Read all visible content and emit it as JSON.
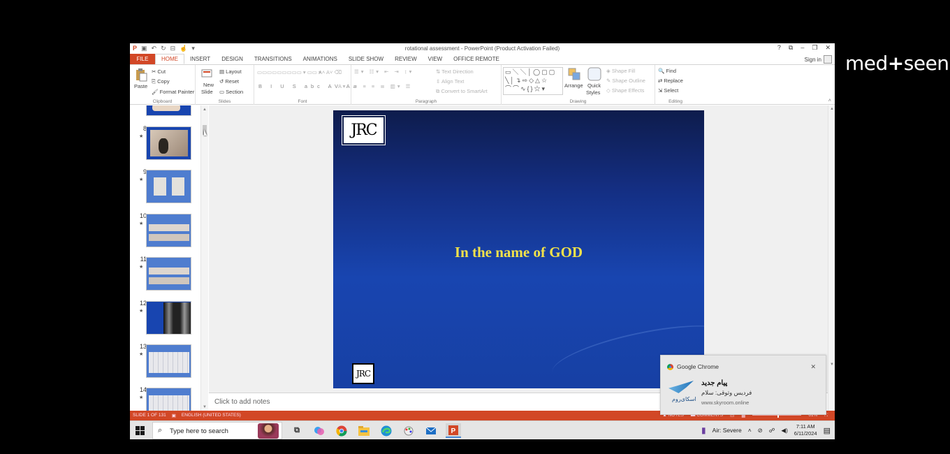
{
  "watermark": {
    "brand": "med",
    "plus": "+",
    "rest": "seen"
  },
  "window": {
    "title": "rotational assessment - PowerPoint (Product Activation Failed)",
    "controls": [
      "?",
      "⧉",
      "–",
      "❐",
      "✕"
    ],
    "sign_in": "Sign in"
  },
  "tabs": {
    "file": "FILE",
    "items": [
      "HOME",
      "INSERT",
      "DESIGN",
      "TRANSITIONS",
      "ANIMATIONS",
      "SLIDE SHOW",
      "REVIEW",
      "VIEW",
      "OFFICE REMOTE"
    ],
    "active": "HOME"
  },
  "ribbon": {
    "clipboard": {
      "paste": "Paste",
      "cut": "Cut",
      "copy": "Copy",
      "format_painter": "Format Painter",
      "label": "Clipboard"
    },
    "slides": {
      "new_slide": "New",
      "new_slide_2": "Slide",
      "layout": "Layout",
      "reset": "Reset",
      "section": "Section",
      "label": "Slides"
    },
    "font": {
      "label": "Font"
    },
    "paragraph": {
      "text_direction": "Text Direction",
      "align_text": "Align Text",
      "convert": "Convert to SmartArt",
      "label": "Paragraph"
    },
    "drawing": {
      "arrange": "Arrange",
      "quick_styles": "Quick",
      "quick_styles_2": "Styles",
      "shape_fill": "Shape Fill",
      "shape_outline": "Shape Outline",
      "shape_effects": "Shape Effects",
      "label": "Drawing"
    },
    "editing": {
      "find": "Find",
      "replace": "Replace",
      "select": "Select",
      "label": "Editing"
    }
  },
  "thumbnails": [
    {
      "num": "",
      "kind": "partial"
    },
    {
      "num": "8",
      "kind": "photo"
    },
    {
      "num": "9",
      "kind": "blue-two"
    },
    {
      "num": "10",
      "kind": "blue-rows"
    },
    {
      "num": "11",
      "kind": "blue-rows"
    },
    {
      "num": "12",
      "kind": "xray"
    },
    {
      "num": "13",
      "kind": "blue-grid"
    },
    {
      "num": "14",
      "kind": "blue-grid"
    }
  ],
  "slide": {
    "logo": "JRC",
    "logo_small": "JRC",
    "headline": "In the name of GOD"
  },
  "notes": {
    "placeholder": "Click to add notes"
  },
  "statusbar": {
    "slide": "SLIDE 1 OF 131",
    "language": "ENGLISH (UNITED STATES)",
    "notes": "NOTES",
    "comments": "COMMENTS",
    "zoom": "61%"
  },
  "taskbar": {
    "search_placeholder": "Type here to search",
    "apps": [
      "task-view",
      "copilot",
      "chrome",
      "file-explorer",
      "edge",
      "paint",
      "outlook",
      "powerpoint"
    ],
    "tray_label": "Air: Severe",
    "time": "7:11 AM",
    "date": "6/11/2024"
  },
  "toast": {
    "app": "Google Chrome",
    "title": "پیام جدید",
    "body": "فردیس وثوقی: سلام",
    "url": "www.skyroom.online",
    "brand": "اسکای‌روم"
  },
  "colors": {
    "accent": "#d24726",
    "slide_bg": "#1845b0",
    "headline": "#f2e24a"
  }
}
